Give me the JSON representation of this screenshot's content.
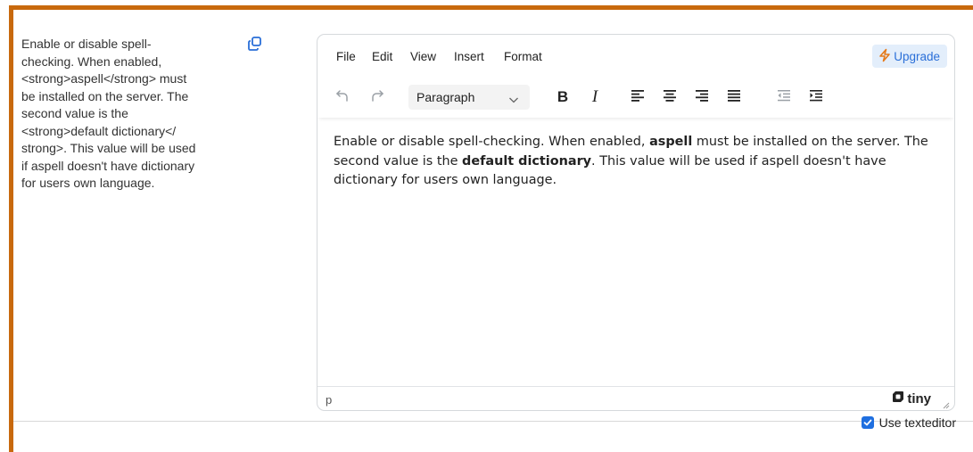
{
  "setting": {
    "description": "Enable or disable spell-\nchecking. When enabled,\n<strong>aspell</strong> must\nbe installed on the server. The\nsecond value is the\n<strong>default dictionary</\nstrong>. This value will be used\nif aspell doesn't have dictionary\nfor users own language."
  },
  "editor": {
    "menu": [
      "File",
      "Edit",
      "View",
      "Insert",
      "Format"
    ],
    "upgrade_label": "Upgrade",
    "block_format": "Paragraph",
    "content": {
      "p1_a": "Enable or disable spell-checking. When enabled, ",
      "p1_b": "aspell",
      "p1_c": " must be installed on the server. The second value is the ",
      "p1_d": "default dictionary",
      "p1_e": ". This value will be used if aspell doesn't have dictionary for users own language."
    },
    "status_path": "p",
    "brand": "tiny"
  },
  "use_texteditor": {
    "label": "Use texteditor",
    "checked": true
  },
  "colors": {
    "frame": "#c8690d",
    "accent": "#1f6fe0",
    "upgrade_bg": "#e3eefb"
  },
  "icons": [
    "copy-icon",
    "undo-icon",
    "redo-icon",
    "chevron-down-icon",
    "bold-icon",
    "italic-icon",
    "align-left-icon",
    "align-center-icon",
    "align-right-icon",
    "align-justify-icon",
    "outdent-icon",
    "indent-icon",
    "lightning-icon",
    "tiny-logo-icon",
    "resize-handle-icon",
    "checkmark-icon"
  ]
}
